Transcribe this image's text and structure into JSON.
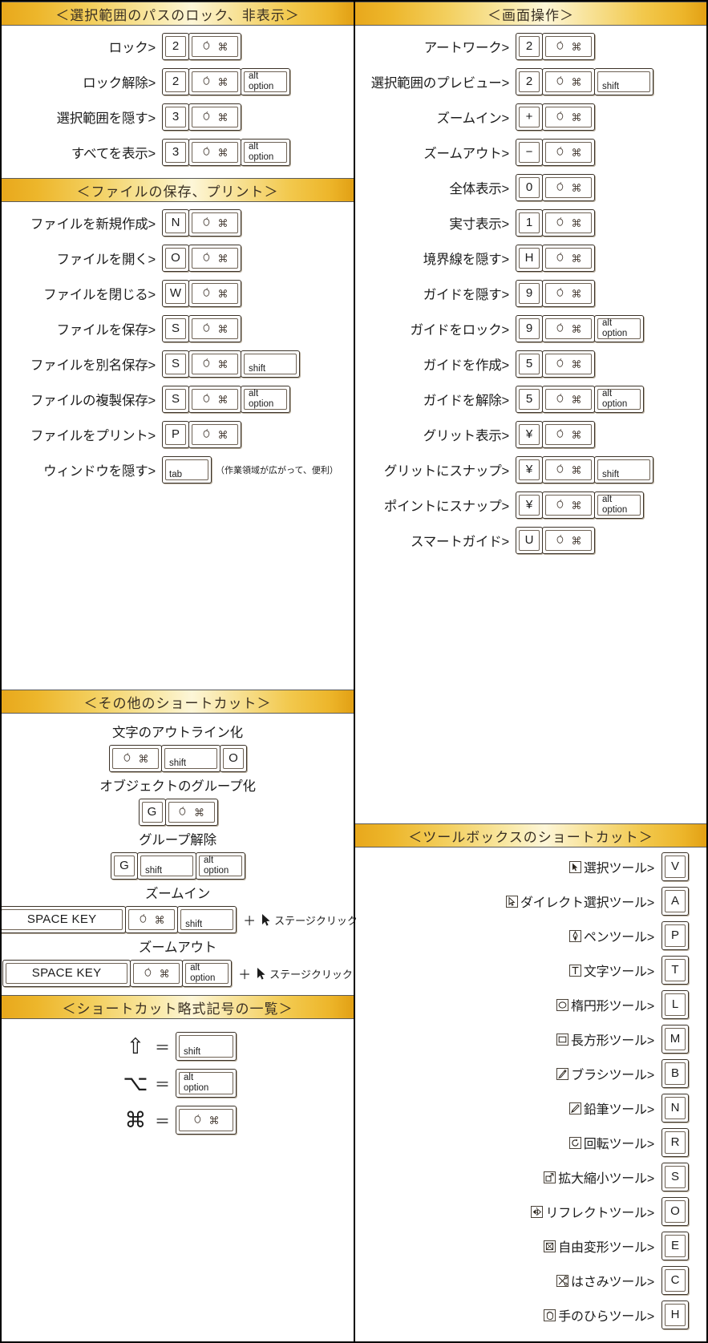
{
  "meta": {
    "accent_gold": "#e8a81c",
    "accent_light": "#fdf6d8",
    "key_border": "#3b3228",
    "text": "#1c1c1c"
  },
  "glyphs": {
    "apple": "○",
    "command": "⌘",
    "shift_symbol": "⇧",
    "option_symbol": "⌥",
    "command_symbol": "⌘",
    "equals": "＝",
    "plus": "+"
  },
  "keycaps": {
    "cmd_label": "cmd-key",
    "alt_option": "alt\noption",
    "alt": "alt",
    "option": "option",
    "shift": "shift",
    "tab": "tab",
    "space": "SPACE KEY"
  },
  "sections": {
    "lock_hide": {
      "title": "＜選択範囲のパスのロック、非表示＞",
      "rows": [
        {
          "label": "ロック>",
          "keys": [
            "2",
            "CMD"
          ]
        },
        {
          "label": "ロック解除>",
          "keys": [
            "2",
            "CMD",
            "ALTOPT"
          ]
        },
        {
          "label": "選択範囲を隠す>",
          "keys": [
            "3",
            "CMD"
          ]
        },
        {
          "label": "すべてを表示>",
          "keys": [
            "3",
            "CMD",
            "ALTOPT"
          ]
        }
      ]
    },
    "file_save_print": {
      "title": "＜ファイルの保存、プリント＞",
      "rows": [
        {
          "label": "ファイルを新規作成>",
          "keys": [
            "N",
            "CMD"
          ]
        },
        {
          "label": "ファイルを開く>",
          "keys": [
            "O",
            "CMD"
          ]
        },
        {
          "label": "ファイルを閉じる>",
          "keys": [
            "W",
            "CMD"
          ]
        },
        {
          "label": "ファイルを保存>",
          "keys": [
            "S",
            "CMD"
          ]
        },
        {
          "label": "ファイルを別名保存>",
          "keys": [
            "S",
            "CMD",
            "SHIFT"
          ]
        },
        {
          "label": "ファイルの複製保存>",
          "keys": [
            "S",
            "CMD",
            "ALTOPT"
          ]
        },
        {
          "label": "ファイルをプリント>",
          "keys": [
            "P",
            "CMD"
          ]
        },
        {
          "label": "ウィンドウを隠す>",
          "keys": [
            "TAB"
          ],
          "note": "（作業領域が広がって、便利）"
        }
      ]
    },
    "screen_ops": {
      "title": "＜画面操作＞",
      "rows": [
        {
          "label": "アートワーク>",
          "keys": [
            "2",
            "CMD"
          ]
        },
        {
          "label": "選択範囲のプレビュー>",
          "keys": [
            "2",
            "CMD",
            "SHIFT"
          ]
        },
        {
          "label": "ズームイン>",
          "keys": [
            "+",
            "CMD"
          ]
        },
        {
          "label": "ズームアウト>",
          "keys": [
            "−",
            "CMD"
          ]
        },
        {
          "label": "全体表示>",
          "keys": [
            "0",
            "CMD"
          ]
        },
        {
          "label": "実寸表示>",
          "keys": [
            "1",
            "CMD"
          ]
        },
        {
          "label": "境界線を隠す>",
          "keys": [
            "H",
            "CMD"
          ]
        },
        {
          "label": "ガイドを隠す>",
          "keys": [
            "9",
            "CMD"
          ]
        },
        {
          "label": "ガイドをロック>",
          "keys": [
            "9",
            "CMD",
            "ALTOPT"
          ]
        },
        {
          "label": "ガイドを作成>",
          "keys": [
            "5",
            "CMD"
          ]
        },
        {
          "label": "ガイドを解除>",
          "keys": [
            "5",
            "CMD",
            "ALTOPT"
          ]
        },
        {
          "label": "グリット表示>",
          "keys": [
            "¥",
            "CMD"
          ]
        },
        {
          "label": "グリットにスナップ>",
          "keys": [
            "¥",
            "CMD",
            "SHIFT"
          ]
        },
        {
          "label": "ポイントにスナップ>",
          "keys": [
            "¥",
            "CMD",
            "ALTOPT"
          ]
        },
        {
          "label": "スマートガイド>",
          "keys": [
            "U",
            "CMD"
          ]
        }
      ]
    },
    "other_shortcuts": {
      "title": "＜その他のショートカット＞",
      "blocks": [
        {
          "title": "文字のアウトライン化",
          "keys": [
            "CMD",
            "SHIFT",
            "O"
          ],
          "click": false
        },
        {
          "title": "オブジェクトのグループ化",
          "keys": [
            "G",
            "CMD"
          ],
          "click": false
        },
        {
          "title": "グループ解除",
          "keys": [
            "G",
            "SHIFT",
            "ALTOPT"
          ],
          "click": false
        },
        {
          "title": "ズームイン",
          "keys": [
            "SPACE",
            "CMD",
            "SHIFT"
          ],
          "click": true,
          "click_label": "ステージクリック",
          "plus": "＋"
        },
        {
          "title": "ズームアウト",
          "keys": [
            "SPACE",
            "CMD",
            "ALTOPT"
          ],
          "click": true,
          "click_label": "ステージクリック",
          "plus": "＋"
        }
      ]
    },
    "symbol_legend": {
      "title": "＜ショートカット略式記号の一覧＞",
      "rows": [
        {
          "symbol": "⇧",
          "equals": "＝",
          "key": "SHIFT"
        },
        {
          "symbol": "⌥",
          "equals": "＝",
          "key": "ALTOPT"
        },
        {
          "symbol": "⌘",
          "equals": "＝",
          "key": "CMD"
        }
      ]
    },
    "toolbox": {
      "title": "＜ツールボックスのショートカット＞",
      "rows": [
        {
          "icon": "selection-tool-icon",
          "label": "選択ツール>",
          "key": "V"
        },
        {
          "icon": "direct-selection-tool-icon",
          "label": "ダイレクト選択ツール>",
          "key": "A"
        },
        {
          "icon": "pen-tool-icon",
          "label": "ペンツール>",
          "key": "P"
        },
        {
          "icon": "type-tool-icon",
          "label": "文字ツール>",
          "key": "T"
        },
        {
          "icon": "ellipse-tool-icon",
          "label": "楕円形ツール>",
          "key": "L"
        },
        {
          "icon": "rectangle-tool-icon",
          "label": "長方形ツール>",
          "key": "M"
        },
        {
          "icon": "brush-tool-icon",
          "label": "ブラシツール>",
          "key": "B"
        },
        {
          "icon": "pencil-tool-icon",
          "label": "鉛筆ツール>",
          "key": "N"
        },
        {
          "icon": "rotate-tool-icon",
          "label": "回転ツール>",
          "key": "R"
        },
        {
          "icon": "scale-tool-icon",
          "label": "拡大縮小ツール>",
          "key": "S"
        },
        {
          "icon": "reflect-tool-icon",
          "label": "リフレクトツール>",
          "key": "O"
        },
        {
          "icon": "free-transform-tool-icon",
          "label": "自由変形ツール>",
          "key": "E"
        },
        {
          "icon": "scissors-tool-icon",
          "label": "はさみツール>",
          "key": "C"
        },
        {
          "icon": "hand-tool-icon",
          "label": "手のひらツール>",
          "key": "H"
        }
      ]
    }
  }
}
